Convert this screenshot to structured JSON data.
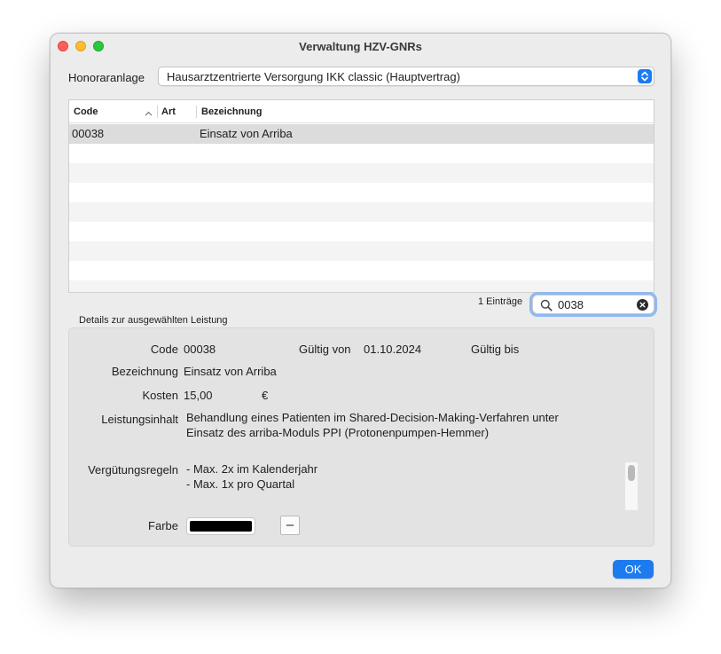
{
  "window": {
    "title": "Verwaltung HZV-GNRs"
  },
  "honorar": {
    "label": "Honoraranlage",
    "selected": "Hausarztzentrierte Versorgung IKK classic (Hauptvertrag)"
  },
  "table": {
    "columns": [
      "Code",
      "Art",
      "Bezeichnung"
    ],
    "rows": [
      {
        "code": "00038",
        "art": "",
        "bezeichnung": "Einsatz von Arriba"
      }
    ]
  },
  "count": "1 Einträge",
  "search": {
    "value": "0038"
  },
  "details": {
    "section_label": "Details zur ausgewählten Leistung",
    "code_label": "Code",
    "code_value": "00038",
    "gueltig_von_label": "Gültig von",
    "gueltig_von_value": "01.10.2024",
    "gueltig_bis_label": "Gültig bis",
    "bezeichnung_label": "Bezeichnung",
    "bezeichnung_value": "Einsatz von Arriba",
    "kosten_label": "Kosten",
    "kosten_value": "15,00",
    "currency": "€",
    "leistungsinhalt_label": "Leistungsinhalt",
    "leistungsinhalt_lines": [
      "Behandlung eines Patienten im Shared-Decision-Making-Verfahren unter",
      "Einsatz des arriba-Moduls PPI (Protonenpumpen-Hemmer)"
    ],
    "verguetung_label": "Vergütungsregeln",
    "verguetung_lines": [
      "- Max. 2x im Kalenderjahr",
      "- Max. 1x pro Quartal"
    ],
    "farbe_label": "Farbe",
    "farbe_color": "#000000",
    "minus_label": "–"
  },
  "ok_label": "OK",
  "colors": {
    "accent": "#1d7bf0",
    "selected_row": "#dcdcdc"
  }
}
